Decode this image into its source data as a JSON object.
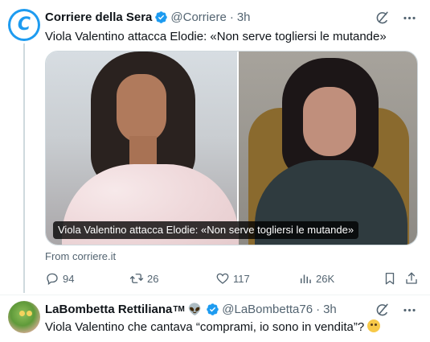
{
  "tweet": {
    "author_name": "Corriere della Sera",
    "avatar_letter": "C",
    "handle": "@Corriere",
    "separator": "·",
    "time": "3h",
    "text": "Viola Valentino attacca Elodie: «Non serve togliersi le mutande»",
    "media_caption": "Viola Valentino attacca Elodie: «Non serve togliersi le mutande»",
    "source": "From corriere.it",
    "stats": {
      "replies": "94",
      "retweets": "26",
      "likes": "117",
      "views": "26K"
    }
  },
  "reply": {
    "author_name": "LaBombetta Rettiliana",
    "author_suffix": "TM",
    "emoji": "👽",
    "handle": "@LaBombetta76",
    "separator": "·",
    "time": "3h",
    "text": "Viola Valentino che cantava “comprami, io sono in vendita”?"
  },
  "colors": {
    "accent": "#1d9bf0",
    "text_primary": "#0f1419",
    "text_secondary": "#536471",
    "border": "#cfd9de"
  },
  "icons": [
    "grok-icon",
    "more-icon",
    "reply-icon",
    "retweet-icon",
    "like-icon",
    "views-icon",
    "bookmark-icon",
    "share-icon",
    "verified-badge-icon",
    "thinking-face-emoji"
  ]
}
